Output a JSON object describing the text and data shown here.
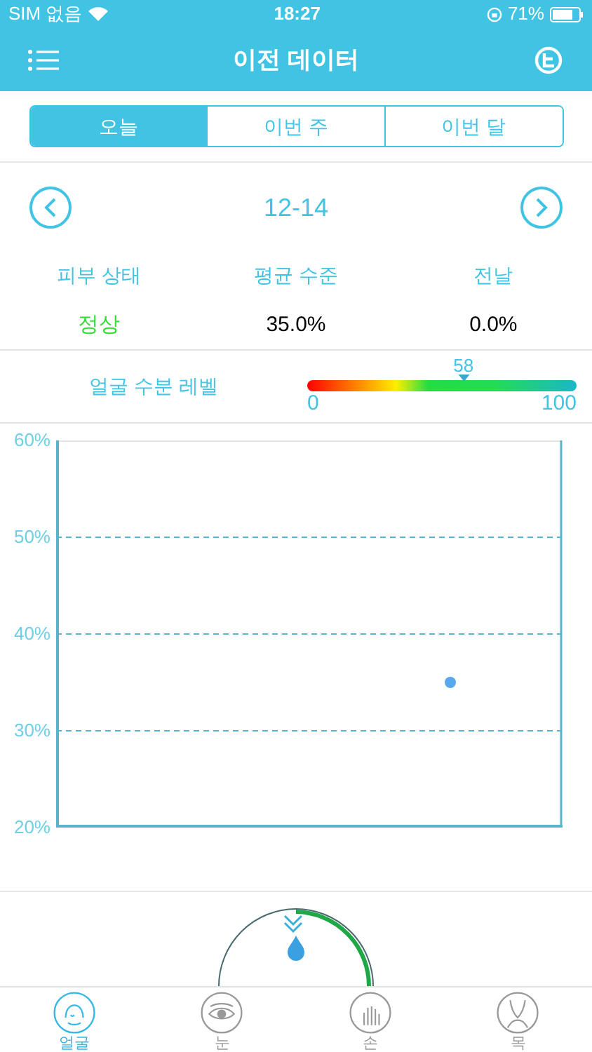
{
  "status_bar": {
    "carrier": "SIM 없음",
    "time": "18:27",
    "battery": "71%"
  },
  "header": {
    "title": "이전 데이터"
  },
  "period_tabs": [
    {
      "label": "오늘",
      "selected": true
    },
    {
      "label": "이번 주",
      "selected": false
    },
    {
      "label": "이번 달",
      "selected": false
    }
  ],
  "date": "12-14",
  "stats": [
    {
      "label": "피부 상태",
      "value": "정상",
      "kind": "status"
    },
    {
      "label": "평균 수준",
      "value": "35.0%",
      "kind": "plain"
    },
    {
      "label": "전날",
      "value": "0.0%",
      "kind": "plain"
    }
  ],
  "moisture": {
    "label": "얼굴 수분 레벨",
    "level": 0.58,
    "reading": "58",
    "min": "0",
    "max": "100"
  },
  "chart": {
    "chart_data": {
      "type": "scatter",
      "grid": true,
      "ylim": [
        20,
        60
      ],
      "yticks": [
        {
          "value": 60,
          "label": "60%"
        },
        {
          "value": 50,
          "label": "50%"
        },
        {
          "value": 40,
          "label": "40%"
        },
        {
          "value": 30,
          "label": "30%"
        },
        {
          "value": 20,
          "label": "20%"
        }
      ],
      "values": [
        35
      ]
    }
  },
  "bottom_tabs": [
    {
      "label": "얼굴",
      "selected": true,
      "kind": "face"
    },
    {
      "label": "눈",
      "selected": false,
      "kind": "eye"
    },
    {
      "label": "손",
      "selected": false,
      "kind": "hand"
    },
    {
      "label": "목",
      "selected": false,
      "kind": "neck"
    }
  ]
}
